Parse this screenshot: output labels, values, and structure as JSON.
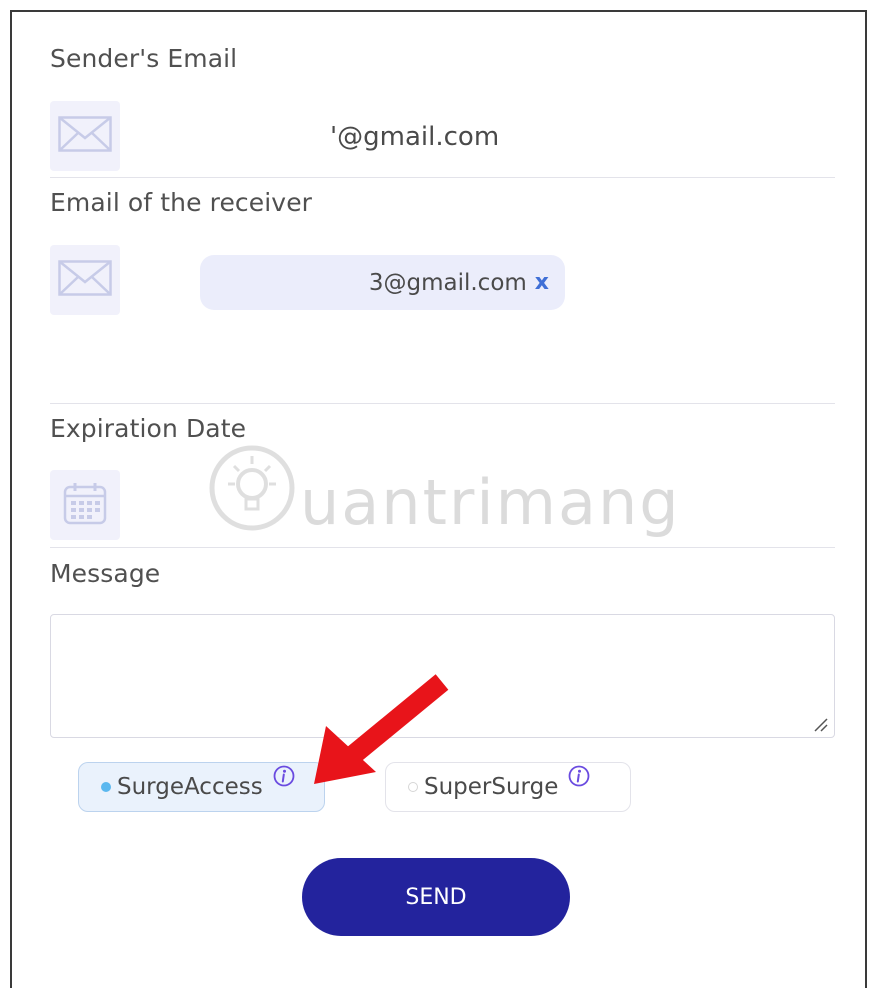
{
  "form": {
    "sender": {
      "label": "Sender's Email",
      "value": "'@gmail.com",
      "icon": "envelope-icon"
    },
    "receiver": {
      "label": "Email of the receiver",
      "chip_value": "3@gmail.com",
      "chip_remove": "x",
      "icon": "envelope-icon"
    },
    "expiration": {
      "label": "Expiration Date",
      "icon": "calendar-icon"
    },
    "message": {
      "label": "Message",
      "value": ""
    },
    "options": [
      {
        "label": "SurgeAccess",
        "selected": true
      },
      {
        "label": "SuperSurge",
        "selected": false
      }
    ],
    "send_label": "SEND"
  },
  "watermark": {
    "text": "uantrimang"
  },
  "colors": {
    "accent": "#23239d",
    "chip_bg": "#ebedfb",
    "selected_option_bg": "#eaf2fc",
    "info_icon": "#6a4be0",
    "annotation_arrow": "#e8141a"
  }
}
